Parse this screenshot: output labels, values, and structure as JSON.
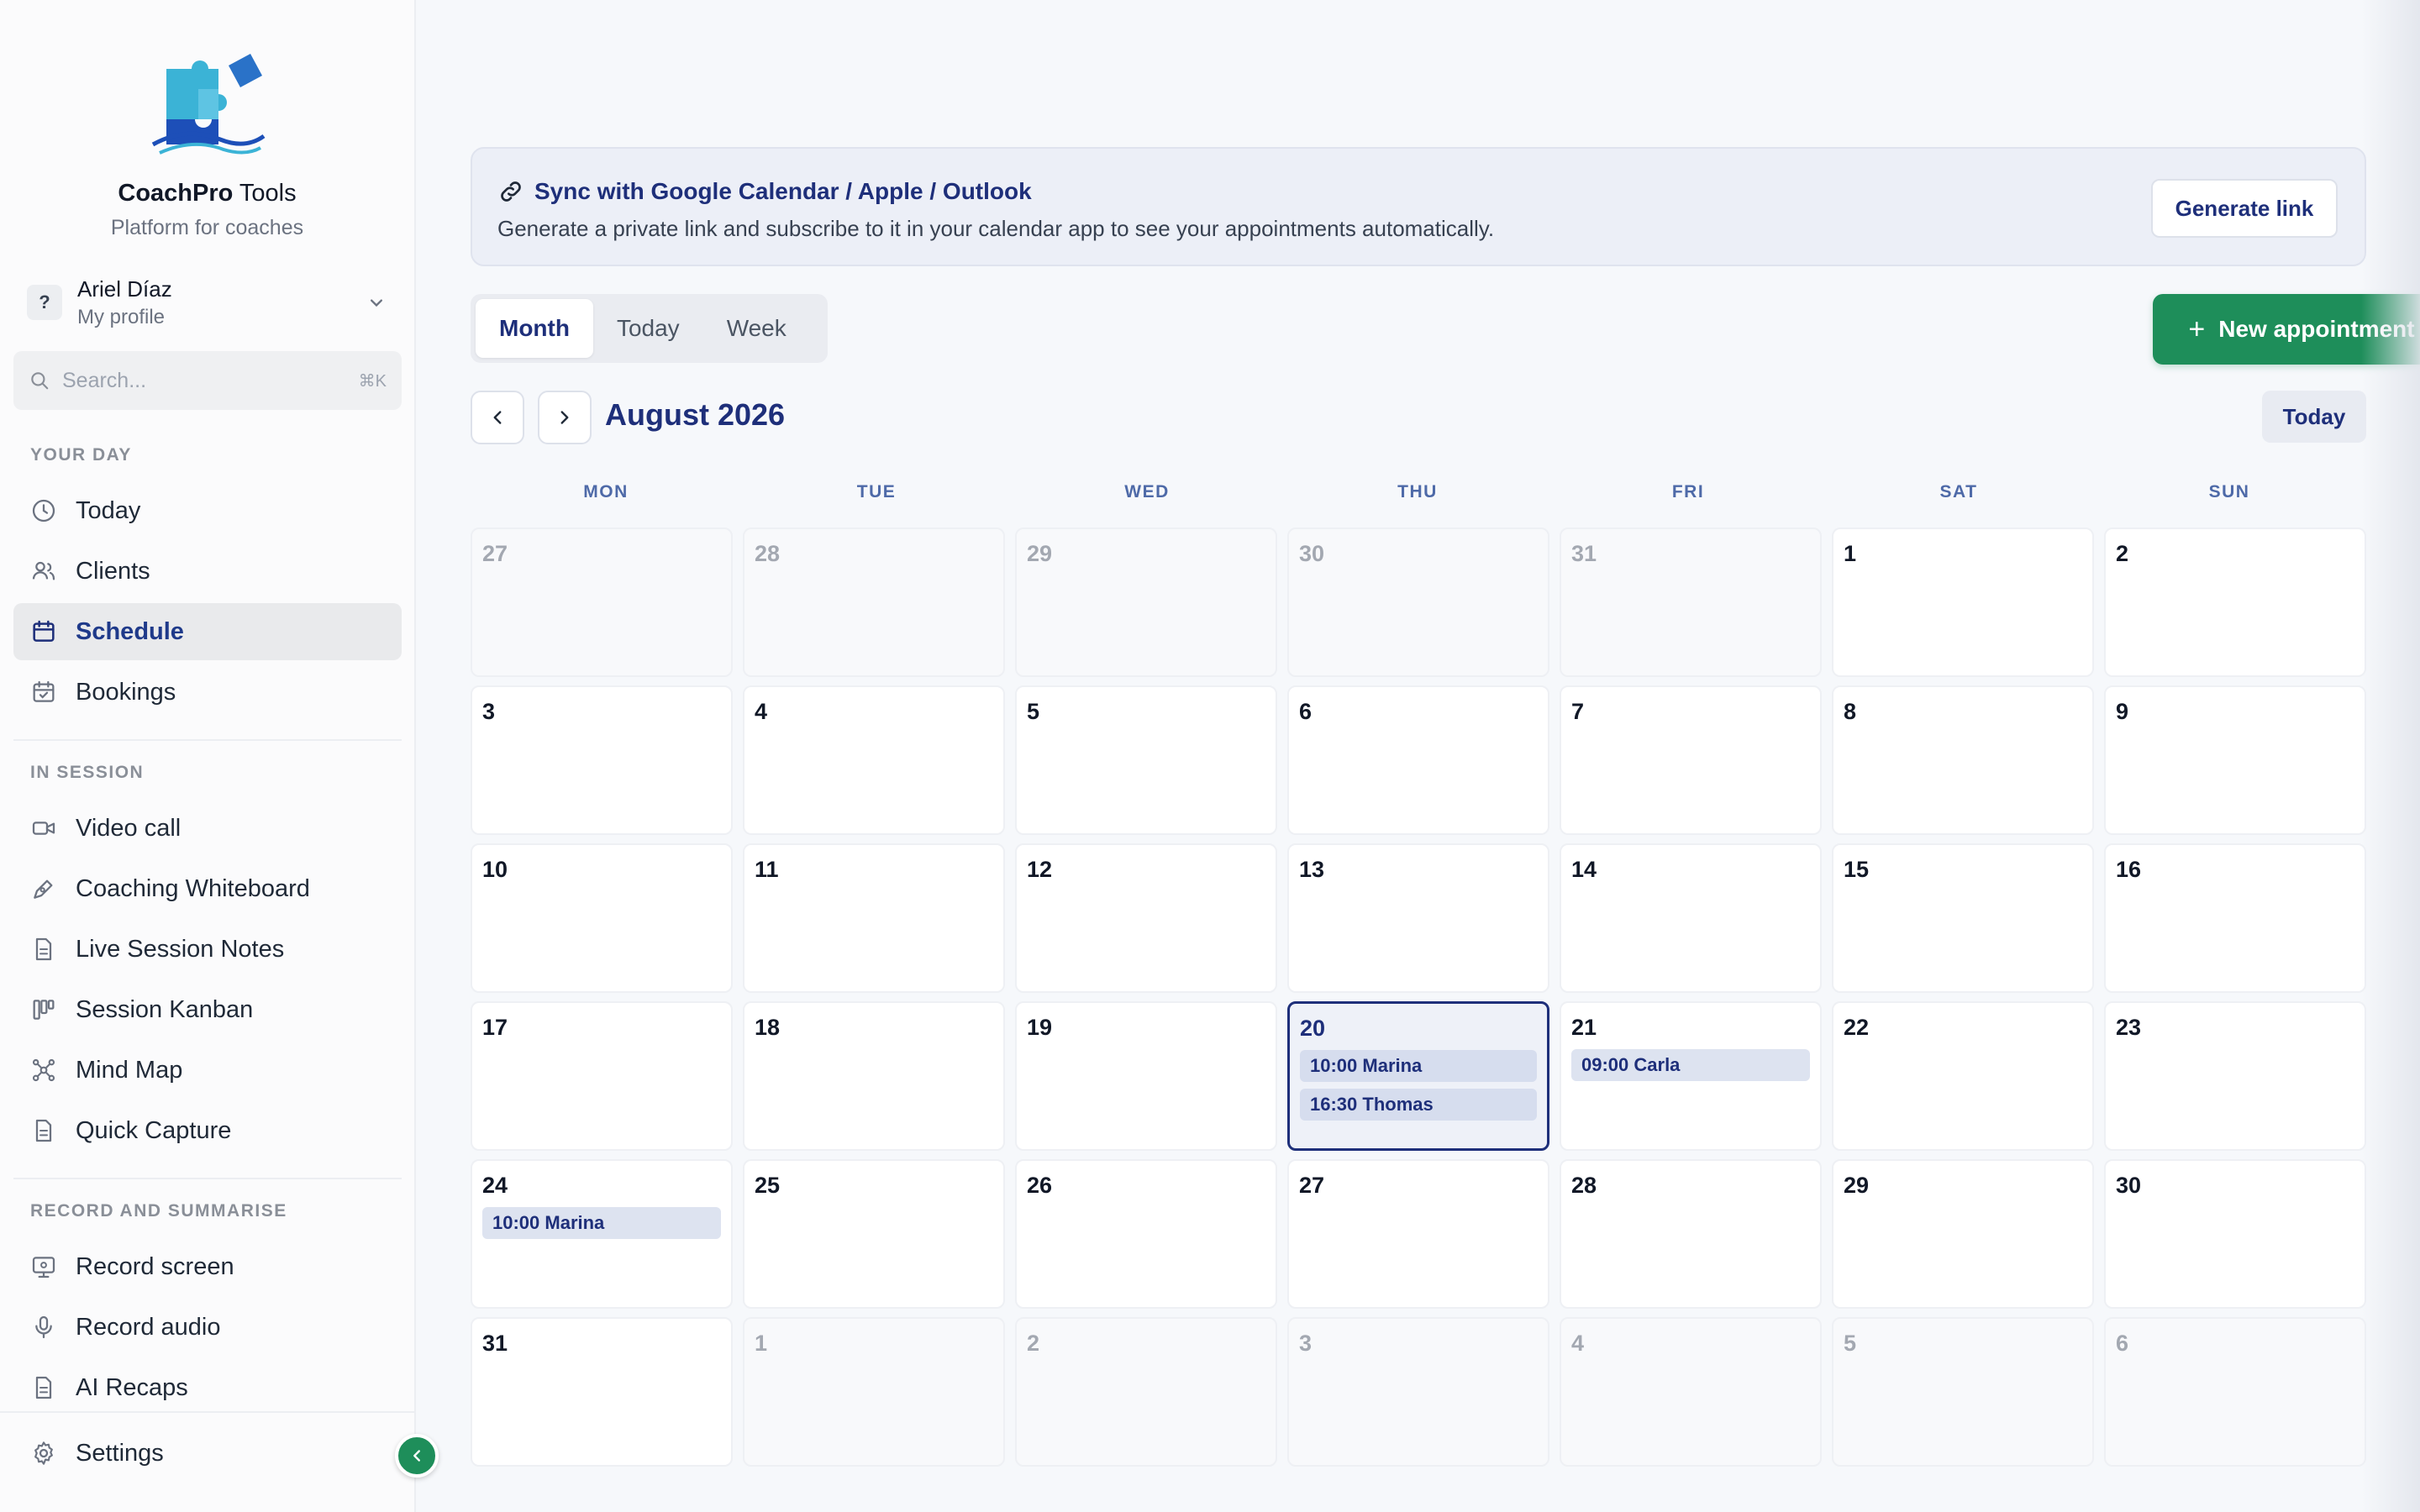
{
  "brand": {
    "name_bold": "CoachPro",
    "name_rest": " Tools",
    "subtitle": "Platform for coaches"
  },
  "profile": {
    "avatar": "?",
    "name": "Ariel Díaz",
    "subtitle": "My profile"
  },
  "search": {
    "placeholder": "Search...",
    "shortcut": "⌘K"
  },
  "sidebar": {
    "sections": [
      {
        "label": "YOUR DAY"
      },
      {
        "label": "IN SESSION"
      },
      {
        "label": "RECORD AND SUMMARISE"
      }
    ],
    "items": [
      {
        "label": "Today",
        "icon": "clock-icon"
      },
      {
        "label": "Clients",
        "icon": "users-icon"
      },
      {
        "label": "Schedule",
        "icon": "calendar-icon",
        "active": true
      },
      {
        "label": "Bookings",
        "icon": "calendar-check-icon"
      },
      {
        "label": "Video call",
        "icon": "video-icon"
      },
      {
        "label": "Coaching Whiteboard",
        "icon": "pen-icon"
      },
      {
        "label": "Live Session Notes",
        "icon": "document-icon"
      },
      {
        "label": "Session Kanban",
        "icon": "kanban-icon"
      },
      {
        "label": "Mind Map",
        "icon": "mindmap-icon"
      },
      {
        "label": "Quick Capture",
        "icon": "document-icon"
      },
      {
        "label": "Record screen",
        "icon": "screen-icon"
      },
      {
        "label": "Record audio",
        "icon": "microphone-icon"
      },
      {
        "label": "AI Recaps",
        "icon": "document-icon"
      }
    ],
    "settings_label": "Settings"
  },
  "sync": {
    "title": "Sync with Google Calendar / Apple / Outlook",
    "description": "Generate a private link and subscribe to it in your calendar app to see your appointments automatically.",
    "button": "Generate link"
  },
  "view_tabs": [
    {
      "label": "Month",
      "active": true
    },
    {
      "label": "Today",
      "active": false
    },
    {
      "label": "Week",
      "active": false
    }
  ],
  "new_appointment": {
    "plus": "+",
    "label": "New appointment"
  },
  "calendar": {
    "month_title": "August 2026",
    "today_button": "Today",
    "weekdays": [
      "MON",
      "TUE",
      "WED",
      "THU",
      "FRI",
      "SAT",
      "SUN"
    ],
    "days": [
      {
        "num": "27",
        "muted": true
      },
      {
        "num": "28",
        "muted": true
      },
      {
        "num": "29",
        "muted": true
      },
      {
        "num": "30",
        "muted": true
      },
      {
        "num": "31",
        "muted": true
      },
      {
        "num": "1"
      },
      {
        "num": "2"
      },
      {
        "num": "3"
      },
      {
        "num": "4"
      },
      {
        "num": "5"
      },
      {
        "num": "6"
      },
      {
        "num": "7"
      },
      {
        "num": "8"
      },
      {
        "num": "9"
      },
      {
        "num": "10"
      },
      {
        "num": "11"
      },
      {
        "num": "12"
      },
      {
        "num": "13"
      },
      {
        "num": "14"
      },
      {
        "num": "15"
      },
      {
        "num": "16"
      },
      {
        "num": "17"
      },
      {
        "num": "18"
      },
      {
        "num": "19"
      },
      {
        "num": "20",
        "today": true,
        "events": [
          "10:00 Marina",
          "16:30 Thomas"
        ]
      },
      {
        "num": "21",
        "events": [
          "09:00 Carla"
        ]
      },
      {
        "num": "22"
      },
      {
        "num": "23"
      },
      {
        "num": "24",
        "events": [
          "10:00 Marina"
        ]
      },
      {
        "num": "25"
      },
      {
        "num": "26"
      },
      {
        "num": "27"
      },
      {
        "num": "28"
      },
      {
        "num": "29"
      },
      {
        "num": "30"
      },
      {
        "num": "31"
      },
      {
        "num": "1",
        "muted": true
      },
      {
        "num": "2",
        "muted": true
      },
      {
        "num": "3",
        "muted": true
      },
      {
        "num": "4",
        "muted": true
      },
      {
        "num": "5",
        "muted": true
      },
      {
        "num": "6",
        "muted": true
      }
    ]
  },
  "colors": {
    "primary": "#1e2f7a",
    "accent_green": "#1e8e5a",
    "event_bg": "#dde3f0"
  }
}
